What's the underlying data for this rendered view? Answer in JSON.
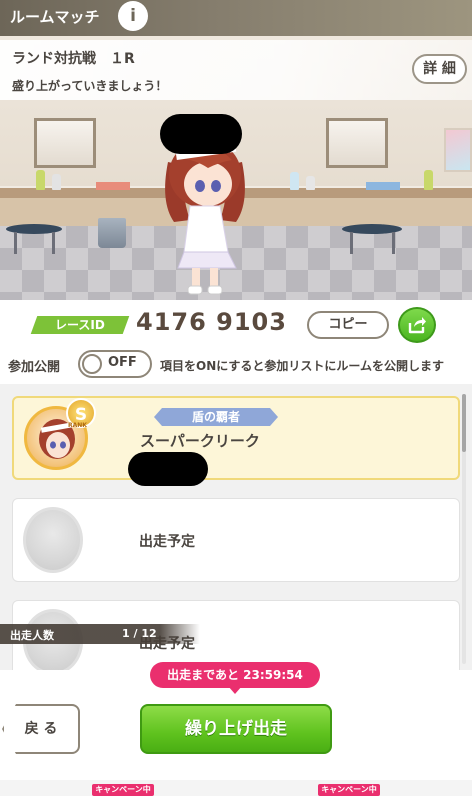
{
  "header": {
    "title": "ルームマッチ",
    "info_icon": "i"
  },
  "room": {
    "title": "ランド対抗戦　１R",
    "message": "盛り上がっていきましょう！",
    "details_label": "詳 細"
  },
  "race_id": {
    "label": "レースID",
    "value": "4176 9103",
    "copy_label": "コピー"
  },
  "public": {
    "label": "参加公開",
    "toggle_state": "OFF",
    "hint": "項目をONにすると参加リストにルームを公開します"
  },
  "participants": [
    {
      "title": "盾の覇者",
      "name": "スーパークリーク",
      "rank": "S",
      "rank_sub": "RANK"
    },
    {
      "status": "出走予定"
    },
    {
      "status": "出走予定"
    }
  ],
  "entrants": {
    "label": "出走人数",
    "count": "1 / 12"
  },
  "countdown": "出走まであと 23:59:54",
  "buttons": {
    "back": "戻 る",
    "start": "繰り上げ出走"
  },
  "campaign_tags": [
    "キャンペーン中",
    "キャンペーン中"
  ],
  "colors": {
    "accent_green": "#5fc21e",
    "countdown_pink": "#ea2f6e",
    "header_bg": "#857d6d"
  }
}
